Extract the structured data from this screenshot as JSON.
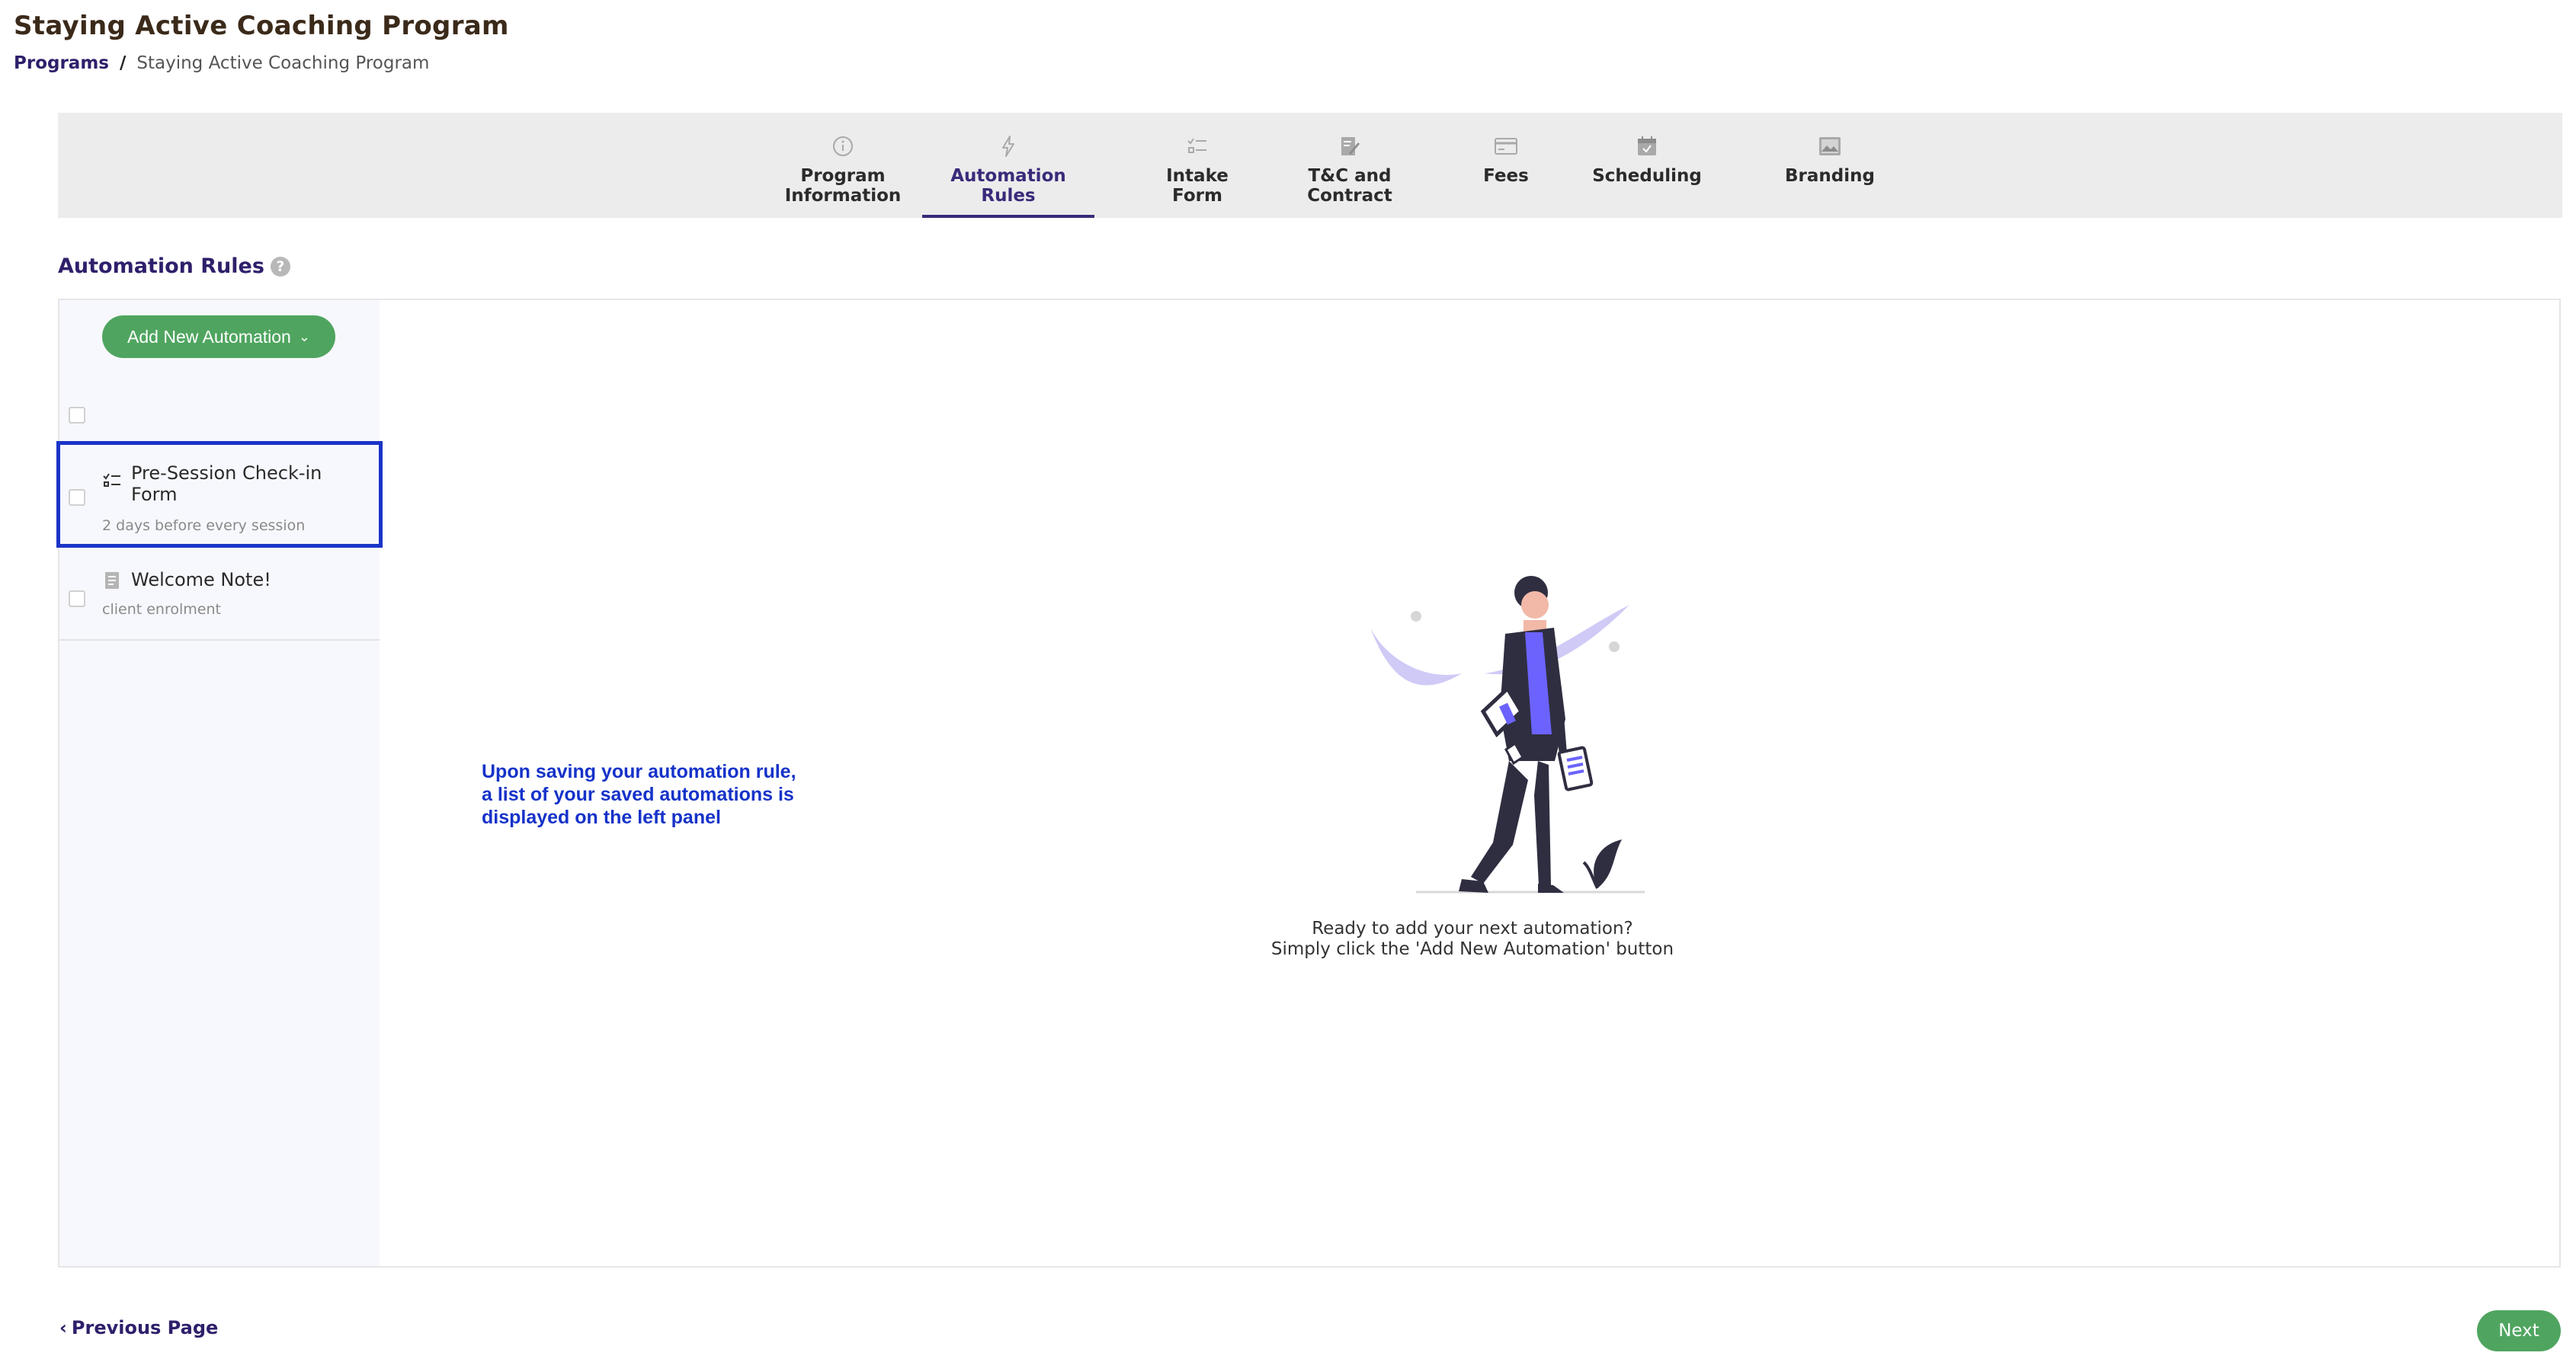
{
  "page": {
    "title": "Staying Active Coaching Program"
  },
  "breadcrumb": {
    "root": "Programs",
    "separator": "/",
    "current": "Staying Active Coaching Program"
  },
  "tabs": [
    {
      "label": "Program\nInformation",
      "icon": "info-circle-icon"
    },
    {
      "label": "Automation\nRules",
      "icon": "lightning-icon",
      "active": true
    },
    {
      "label": "Intake\nForm",
      "icon": "checklist-icon"
    },
    {
      "label": "T&C and\nContract",
      "icon": "document-edit-icon"
    },
    {
      "label": "Fees",
      "icon": "credit-card-icon"
    },
    {
      "label": "Scheduling",
      "icon": "calendar-icon"
    },
    {
      "label": "Branding",
      "icon": "image-icon"
    }
  ],
  "section": {
    "title": "Automation Rules",
    "help": "?"
  },
  "left_panel": {
    "add_button": "Add New Automation",
    "automations": [
      {
        "title": "Pre-Session Check-in Form",
        "subtitle": "2 days before every session",
        "icon": "checklist-icon"
      },
      {
        "title": "Welcome Note!",
        "subtitle": "client enrolment",
        "icon": "note-icon"
      }
    ]
  },
  "annotation": {
    "text": "Upon saving your automation rule,\na list of your saved automations is\ndisplayed on the left panel",
    "color": "#1532c9"
  },
  "empty_state": {
    "line1": "Ready to add your next automation?",
    "line2": "Simply click the 'Add New Automation' button"
  },
  "footer": {
    "previous": "Previous Page",
    "next": "Next"
  },
  "colors": {
    "accent_green": "#4fa55f",
    "primary_purple": "#2f1f6b",
    "highlight_blue": "#1a34c8",
    "illustration_purple": "#6c63ff"
  }
}
